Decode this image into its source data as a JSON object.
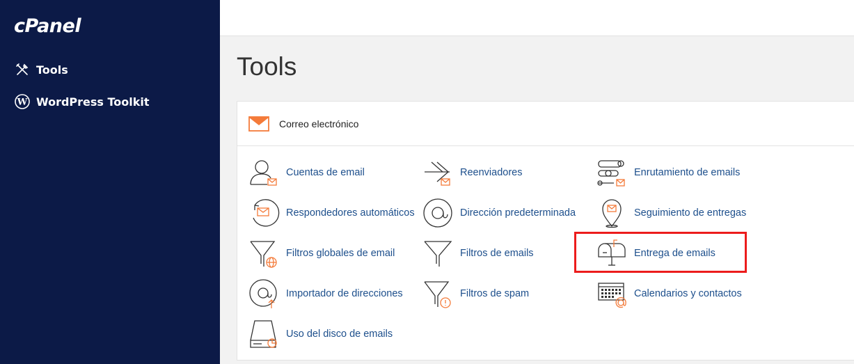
{
  "sidebar": {
    "logo": "cPanel",
    "items": [
      {
        "label": "Tools",
        "icon": "tools-icon"
      },
      {
        "label": "WordPress Toolkit",
        "icon": "wordpress-icon"
      }
    ]
  },
  "main": {
    "title": "Tools",
    "section": {
      "title": "Correo electrónico",
      "icon": "envelope-icon",
      "tools": [
        {
          "label": "Cuentas de email",
          "icon": "user-email-icon"
        },
        {
          "label": "Reenviadores",
          "icon": "forward-arrows-icon"
        },
        {
          "label": "Enrutamiento de emails",
          "icon": "routing-icon"
        },
        {
          "label": "Respondedores automáticos",
          "icon": "autoresponder-icon"
        },
        {
          "label": "Dirección predeterminada",
          "icon": "at-sign-icon"
        },
        {
          "label": "Seguimiento de entregas",
          "icon": "location-pin-icon"
        },
        {
          "label": "Filtros globales de email",
          "icon": "filter-globe-icon"
        },
        {
          "label": "Filtros de emails",
          "icon": "filter-icon"
        },
        {
          "label": "Entrega de emails",
          "icon": "mailbox-icon"
        },
        {
          "label": "Importador de direcciones",
          "icon": "at-import-icon"
        },
        {
          "label": "Filtros de spam",
          "icon": "filter-spam-icon"
        },
        {
          "label": "Calendarios y contactos",
          "icon": "calendar-icon"
        },
        {
          "label": "Uso del disco de emails",
          "icon": "disk-usage-icon"
        }
      ]
    }
  },
  "colors": {
    "sidebar_bg": "#0c1a47",
    "link": "#1d4f8c",
    "accent": "#f47b3a",
    "highlight": "#ec1c1c"
  }
}
